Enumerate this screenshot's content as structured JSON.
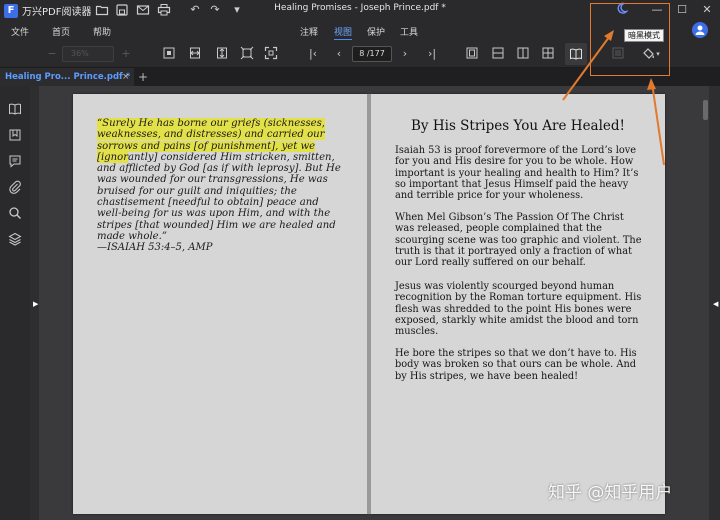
{
  "app": {
    "logo_letter": "F",
    "name": "万兴PDF阅读器",
    "doc_title": "Healing Promises - Joseph Prince.pdf *"
  },
  "titlebar": {
    "icons": [
      "open-folder-icon",
      "save-icon",
      "mail-icon",
      "print-icon",
      "undo-icon",
      "redo-icon",
      "quick-access-dropdown-icon",
      "dark-mode-moon-icon",
      "minimize-icon",
      "maximize-icon",
      "close-icon"
    ]
  },
  "menu": {
    "file": "文件",
    "home": "首页",
    "help": "帮助"
  },
  "tabs": {
    "comment": "注释",
    "view": "视图",
    "protect": "保护",
    "tools": "工具"
  },
  "toolbar": {
    "zoom_value": "36%",
    "page_value": "8 /177",
    "tooltip": "暗黑模式"
  },
  "document_tab": {
    "label": "Healing Pro... Prince.pdf *",
    "close": "×",
    "add": "+"
  },
  "left_page": {
    "quote_highlighted": "“Surely He has borne our griefs (sicknesses, weaknesses, and distresses) and carried our sorrows and pains [of punishment], yet we [ignor",
    "quote_rest": "antly] considered Him stricken, smitten, and afflicted by God [as if with leprosy]. But He was wounded for our transgressions, He was bruised for our guilt and iniquities; the chastisement [needful to obtain] peace and well-being for us was upon Him, and with the stripes [that wounded] Him we are healed and made whole.”",
    "citation": "—ISAIAH 53:4–5, AMP"
  },
  "right_page": {
    "title": "By His Stripes You Are Healed!",
    "paragraphs": [
      "Isaiah 53 is proof forevermore of the Lord’s love for you and His desire for you to be whole. How important is your healing and health to Him? It’s so important that Jesus Himself paid the heavy and terrible price for your wholeness.",
      "When Mel Gibson’s The Passion Of The Christ was released, people complained that the scourging scene was too graphic and violent. The truth is that it portrayed only a fraction of what our Lord really suffered on our behalf.",
      "Jesus was violently scourged beyond human recognition by the Roman torture equipment. His flesh was shredded to the point His bones were exposed, starkly white amidst the blood and torn muscles.",
      "He bore the stripes so that we don’t have to. His body was broken so that ours can be whole. And by His stripes, we have been healed!"
    ]
  },
  "watermark": "知乎 @知乎用户",
  "colors": {
    "accent": "#4a8cff",
    "highlight": "#e3e14a",
    "annotation": "#e07a2e"
  }
}
